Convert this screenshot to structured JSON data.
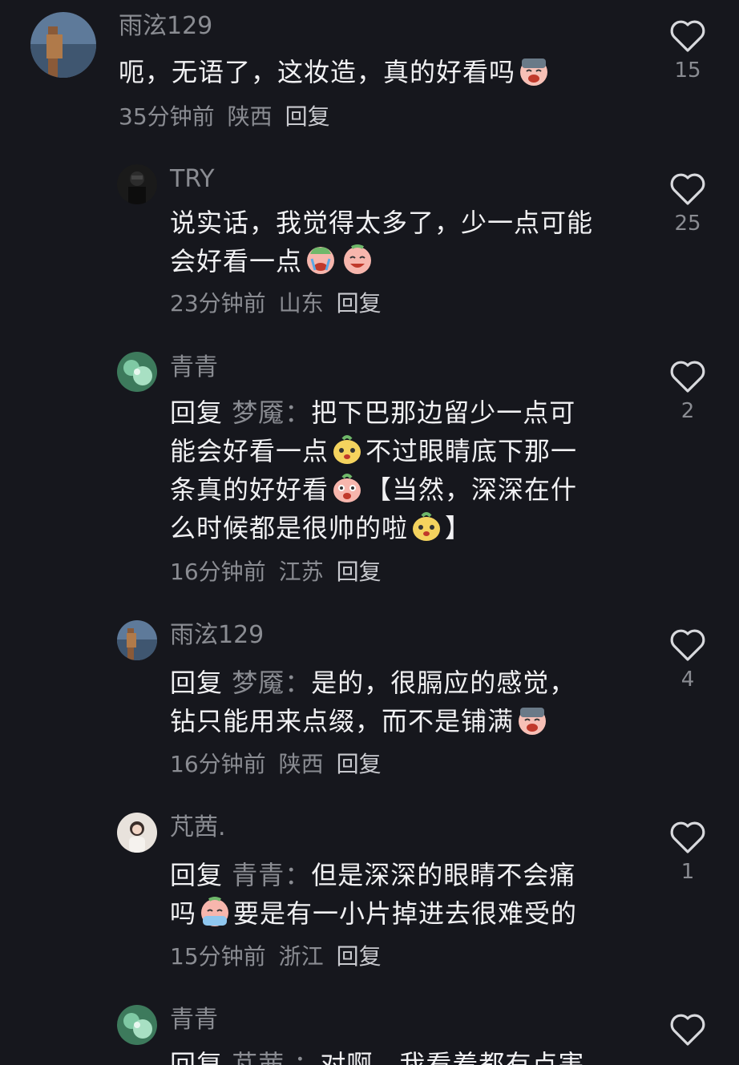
{
  "comments": [
    {
      "user": "雨泫129",
      "text_before": "呃，无语了，这妆造，真的好看吗",
      "emojis": [
        "crying-face"
      ],
      "time": "35分钟前",
      "location": "陕西",
      "reply_label": "回复",
      "likes": "15"
    },
    {
      "user": "TRY",
      "line1": "说实话，我觉得太多了，少一点可能",
      "line2": "会好看一点",
      "emojis": [
        "sobbing-face",
        "laughing-tears-face"
      ],
      "time": "23分钟前",
      "location": "山东",
      "reply_label": "回复",
      "likes": "25"
    },
    {
      "user": "青青",
      "reply_word": "回复",
      "reply_to": "梦魇：",
      "seg1": "把下巴那边留少一点可",
      "seg2": "能会好看一点",
      "seg3": "不过眼睛底下那一",
      "seg4": "条真的好好看",
      "seg5": "【当然，深深在什",
      "seg6": "么时候都是很帅的啦",
      "seg7": "】",
      "emojis": [
        "yellow-blob-face",
        "pink-blob-face",
        "yellow-blob-face"
      ],
      "time": "16分钟前",
      "location": "江苏",
      "reply_label": "回复",
      "likes": "2"
    },
    {
      "user": "雨泫129",
      "reply_word": "回复",
      "reply_to": "梦魇：",
      "line1": "是的，很膈应的感觉，",
      "line2": "钻只能用来点缀，而不是铺满",
      "emojis": [
        "crying-face"
      ],
      "time": "16分钟前",
      "location": "陕西",
      "reply_label": "回复",
      "likes": "4"
    },
    {
      "user": "芃茜.",
      "reply_word": "回复",
      "reply_to": "青青：",
      "line1": "但是深深的眼睛不会痛",
      "line2a": "吗",
      "line2b": "要是有一小片掉进去很难受的",
      "emojis": [
        "tearful-face"
      ],
      "time": "15分钟前",
      "location": "浙江",
      "reply_label": "回复",
      "likes": "1"
    },
    {
      "user": "青青",
      "reply_word": "回复",
      "reply_to": "芃茜.：",
      "line1": "对啊，我看着都有点害"
    }
  ],
  "colors": {
    "background": "#16171d",
    "text": "#f1f1f3",
    "muted": "#8a8c92"
  }
}
